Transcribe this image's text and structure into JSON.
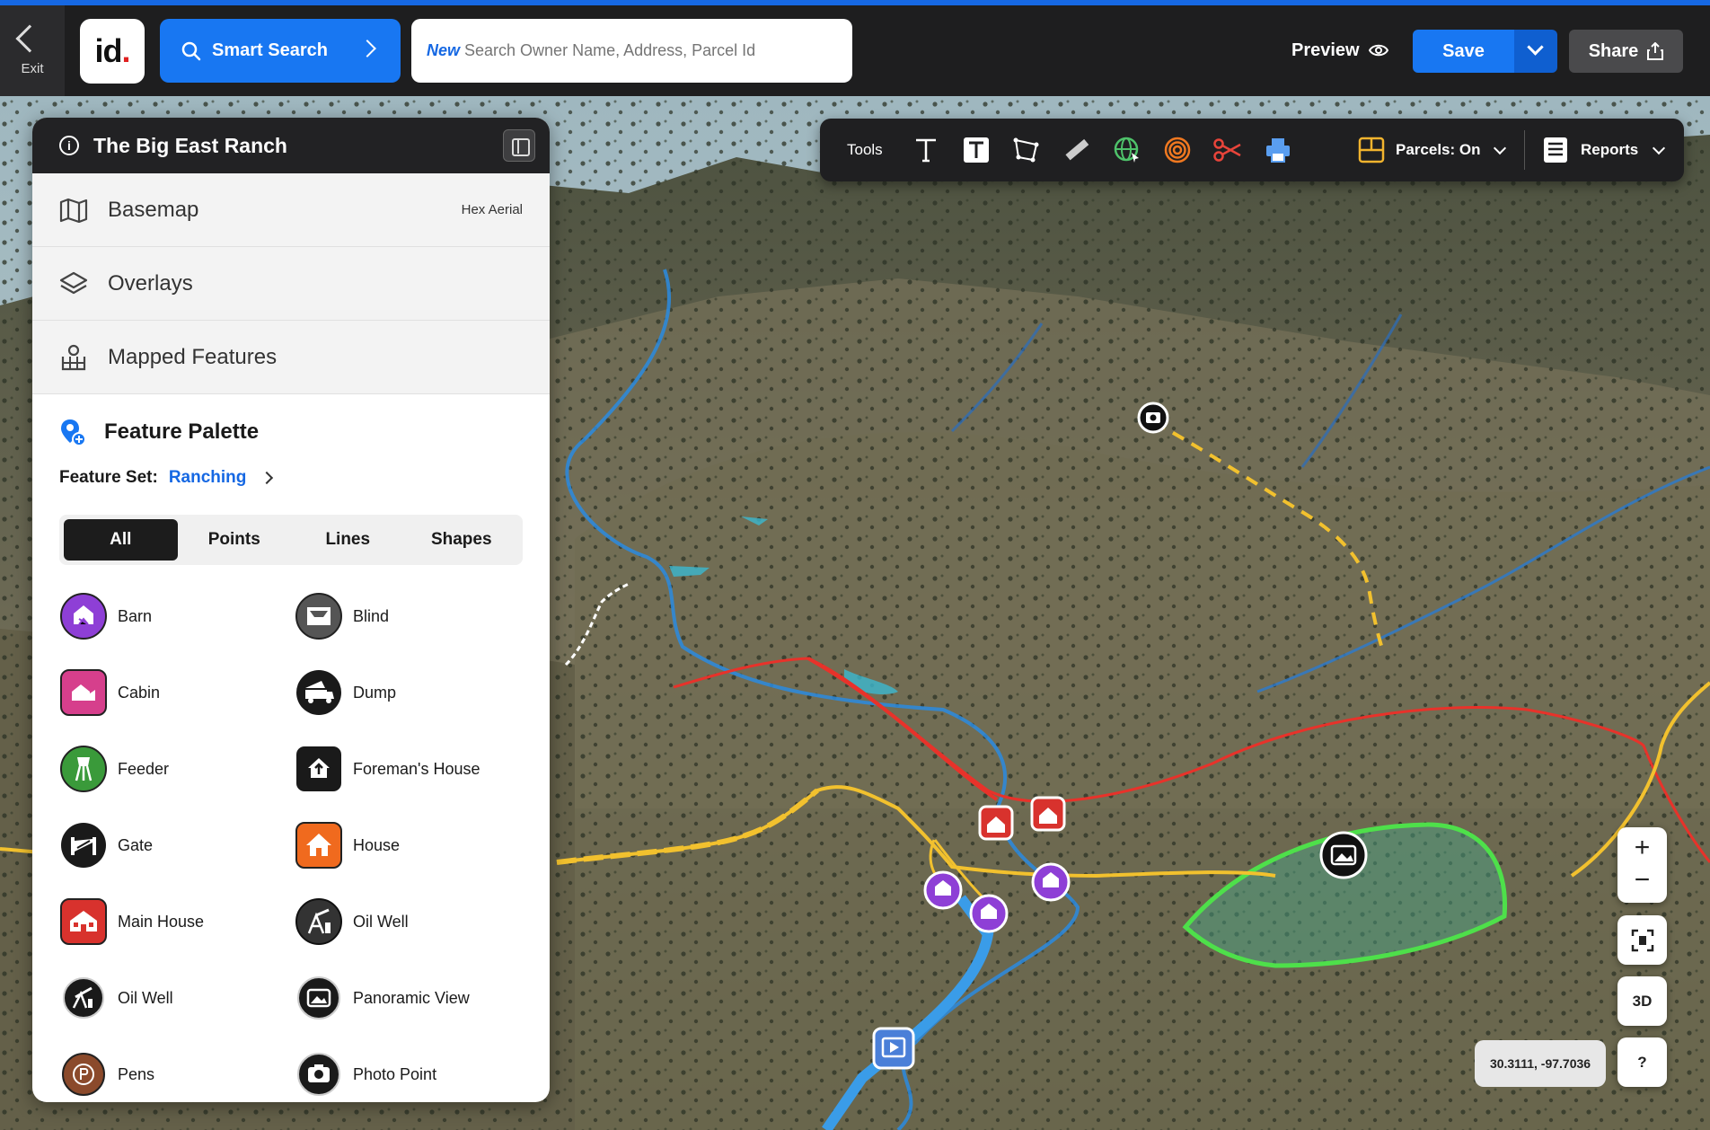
{
  "topbar": {
    "exit_label": "Exit",
    "logo_text": "id",
    "logo_dot": ".",
    "smart_search_label": "Smart Search",
    "search_new_label": "New",
    "search_placeholder": "Search Owner Name, Address, Parcel Id",
    "preview_label": "Preview",
    "save_label": "Save",
    "share_label": "Share"
  },
  "panel": {
    "title": "The Big East Ranch",
    "rows": [
      {
        "label": "Basemap",
        "value": "Hex Aerial"
      },
      {
        "label": "Overlays",
        "value": ""
      },
      {
        "label": "Mapped Features",
        "value": ""
      }
    ],
    "palette_title": "Feature Palette",
    "feature_set_label": "Feature Set:",
    "feature_set_value": "Ranching",
    "tabs": [
      "All",
      "Points",
      "Lines",
      "Shapes"
    ],
    "active_tab": "All",
    "features": [
      {
        "label": "Barn",
        "icon": "barn-icon",
        "color": "#8e3fd6"
      },
      {
        "label": "Blind",
        "icon": "blind-icon",
        "color": "#555555"
      },
      {
        "label": "Cabin",
        "icon": "cabin-icon",
        "color": "#d63f8c"
      },
      {
        "label": "Dump",
        "icon": "dump-icon",
        "color": "#1a1a1a"
      },
      {
        "label": "Feeder",
        "icon": "feeder-icon",
        "color": "#3a9a3a"
      },
      {
        "label": "Foreman's House",
        "icon": "foremans-house-icon",
        "color": "#1a1a1a"
      },
      {
        "label": "Gate",
        "icon": "gate-icon",
        "color": "#1a1a1a"
      },
      {
        "label": "House",
        "icon": "house-icon",
        "color": "#f06a1e"
      },
      {
        "label": "Main House",
        "icon": "main-house-icon",
        "color": "#d8322d"
      },
      {
        "label": "Oil Well",
        "icon": "oil-well-icon",
        "color": "#333333"
      },
      {
        "label": "Oil Well",
        "icon": "oil-well-icon",
        "color": "#1a1a1a"
      },
      {
        "label": "Panoramic View",
        "icon": "panoramic-view-icon",
        "color": "#1a1a1a"
      },
      {
        "label": "Pens",
        "icon": "pens-icon",
        "color": "#8b4a2b"
      },
      {
        "label": "Photo Point",
        "icon": "photo-point-icon",
        "color": "#1a1a1a"
      }
    ]
  },
  "toolbar": {
    "tools_label": "Tools",
    "parcels_label": "Parcels: On",
    "reports_label": "Reports"
  },
  "map": {
    "coordinates": "30.3111, -97.7036",
    "zoom_in": "+",
    "zoom_out": "−",
    "mode_3d": "3D",
    "help": "?"
  },
  "colors": {
    "accent": "#1877f2",
    "topbar": "#1e1e1f",
    "boundary_red": "#e8322a",
    "trail_yellow": "#f2c12e",
    "stream_blue": "#2a8be0",
    "pasture_green": "#4ee04a"
  }
}
